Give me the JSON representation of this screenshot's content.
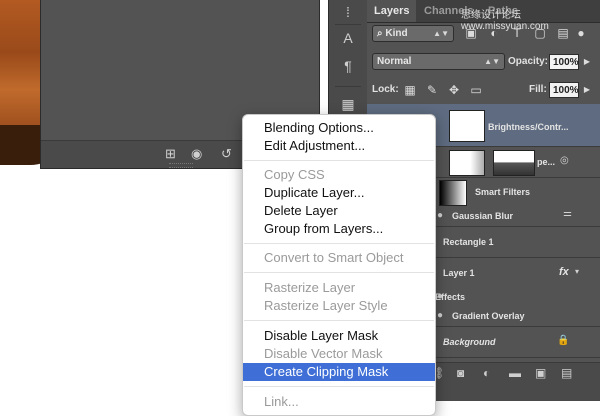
{
  "left_panel": {
    "bottom_icons": [
      "add-cell-icon",
      "eye-link-icon",
      "reset-icon",
      "trash-icon"
    ]
  },
  "tool_strip": {
    "icons": [
      "grip-icon",
      "character-icon",
      "paragraph-icon",
      "grid-icon"
    ]
  },
  "layers_panel": {
    "tabs": [
      "Layers",
      "Channels",
      "Paths"
    ],
    "watermark": "思缘设计论坛 www.missyuan.com",
    "filter": {
      "value": "Kind",
      "icon": "search-icon"
    },
    "filter_icons": [
      "image-icon",
      "adjustment-icon",
      "type-icon",
      "shape-icon",
      "smart-object-icon"
    ],
    "blend_mode": "Normal",
    "opacity_label": "Opacity:",
    "opacity_value": "100%",
    "lock_label": "Lock:",
    "fill_label": "Fill:",
    "fill_value": "100%",
    "layers": [
      {
        "name": "Brightness/Contr...",
        "selected": true
      },
      {
        "name": "pe..."
      },
      {
        "name": "Smart Filters"
      },
      {
        "name": "Gaussian Blur"
      },
      {
        "name": "Rectangle 1"
      },
      {
        "name": "Layer 1",
        "badge": "fx"
      },
      {
        "name": "Effects"
      },
      {
        "name": "Gradient Overlay"
      },
      {
        "name": "Background"
      }
    ],
    "bottom_icons": [
      "link-icon",
      "fx-icon",
      "mask-icon",
      "adjustment-layer-icon",
      "folder-icon",
      "new-layer-icon",
      "trash-icon"
    ]
  },
  "context_menu": {
    "groups": [
      [
        {
          "label": "Blending Options...",
          "enabled": true
        },
        {
          "label": "Edit Adjustment...",
          "enabled": true
        }
      ],
      [
        {
          "label": "Copy CSS",
          "enabled": false
        },
        {
          "label": "Duplicate Layer...",
          "enabled": true
        },
        {
          "label": "Delete Layer",
          "enabled": true
        },
        {
          "label": "Group from Layers...",
          "enabled": true
        }
      ],
      [
        {
          "label": "Convert to Smart Object",
          "enabled": false
        }
      ],
      [
        {
          "label": "Rasterize Layer",
          "enabled": false
        },
        {
          "label": "Rasterize Layer Style",
          "enabled": false
        }
      ],
      [
        {
          "label": "Disable Layer Mask",
          "enabled": true
        },
        {
          "label": "Disable Vector Mask",
          "enabled": false
        },
        {
          "label": "Create Clipping Mask",
          "enabled": true,
          "highlighted": true
        }
      ],
      [
        {
          "label": "Link...",
          "enabled": false
        }
      ]
    ]
  },
  "colors": {
    "panel_bg": "#535353",
    "selected_layer": "#5e6b80",
    "menu_highlight": "#3f6fd6"
  }
}
